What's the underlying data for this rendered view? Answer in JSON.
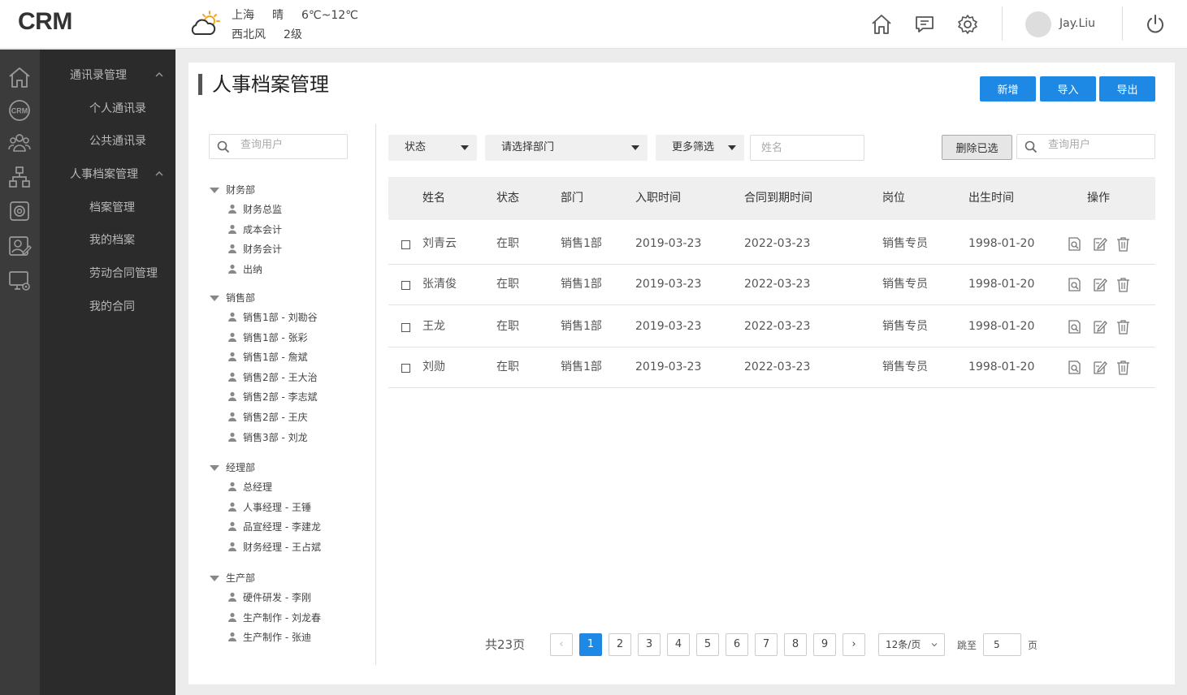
{
  "header": {
    "logo": "CRM",
    "weather": {
      "city": "上海",
      "condition": "晴",
      "temp": "6℃~12℃",
      "wind_dir": "西北风",
      "wind_level": "2级"
    },
    "user": "Jay.Liu"
  },
  "nav": {
    "groups": [
      {
        "label": "通讯录管理",
        "items": [
          "个人通讯录",
          "公共通讯录"
        ]
      },
      {
        "label": "人事档案管理",
        "items": [
          "档案管理",
          "我的档案",
          "劳动合同管理",
          "我的合同"
        ]
      }
    ]
  },
  "page": {
    "title": "人事档案管理",
    "buttons": {
      "add": "新增",
      "import": "导入",
      "export": "导出"
    }
  },
  "tree": {
    "search_placeholder": "查询用户",
    "groups": [
      {
        "label": "财务部",
        "items": [
          "财务总监",
          "成本会计",
          "财务会计",
          "出纳"
        ]
      },
      {
        "label": "销售部",
        "items": [
          "销售1部 - 刘勘谷",
          "销售1部 - 张彩",
          "销售1部 - 詹斌",
          "销售2部 - 王大治",
          "销售2部 - 李志斌",
          "销售2部 - 王庆",
          "销售3部 - 刘龙"
        ]
      },
      {
        "label": "经理部",
        "items": [
          "总经理",
          "人事经理 - 王锤",
          "品宣经理 - 李建龙",
          "财务经理 - 王占斌"
        ]
      },
      {
        "label": "生产部",
        "items": [
          "硬件研发 - 李刚",
          "生产制作 - 刘龙春",
          "生产制作 - 张迪"
        ]
      }
    ]
  },
  "filters": {
    "status": "状态",
    "department": "请选择部门",
    "more": "更多筛选",
    "name_placeholder": "姓名",
    "delete_selected": "删除已选",
    "search_placeholder": "查询用户"
  },
  "table": {
    "columns": [
      "姓名",
      "状态",
      "部门",
      "入职时间",
      "合同到期时间",
      "岗位",
      "出生时间",
      "操作"
    ],
    "rows": [
      [
        "刘青云",
        "在职",
        "销售1部",
        "2019-03-23",
        "2022-03-23",
        "销售专员",
        "1998-01-20"
      ],
      [
        "张清俊",
        "在职",
        "销售1部",
        "2019-03-23",
        "2022-03-23",
        "销售专员",
        "1998-01-20"
      ],
      [
        "王龙",
        "在职",
        "销售1部",
        "2019-03-23",
        "2022-03-23",
        "销售专员",
        "1998-01-20"
      ],
      [
        "刘勋",
        "在职",
        "销售1部",
        "2019-03-23",
        "2022-03-23",
        "销售专员",
        "1998-01-20"
      ]
    ]
  },
  "pagination": {
    "total": "共23页",
    "prev": "‹",
    "next": "›",
    "pages": [
      "1",
      "2",
      "3",
      "4",
      "5",
      "6",
      "7",
      "8",
      "9"
    ],
    "current": "1",
    "per_page": "12条/页",
    "jump_label": "跳至",
    "jump_value": "5",
    "page_suffix": "页"
  },
  "colors": {
    "accent": "#1e88e5",
    "sidebar": "#2b2b2b",
    "rail": "#3b3b3b"
  }
}
